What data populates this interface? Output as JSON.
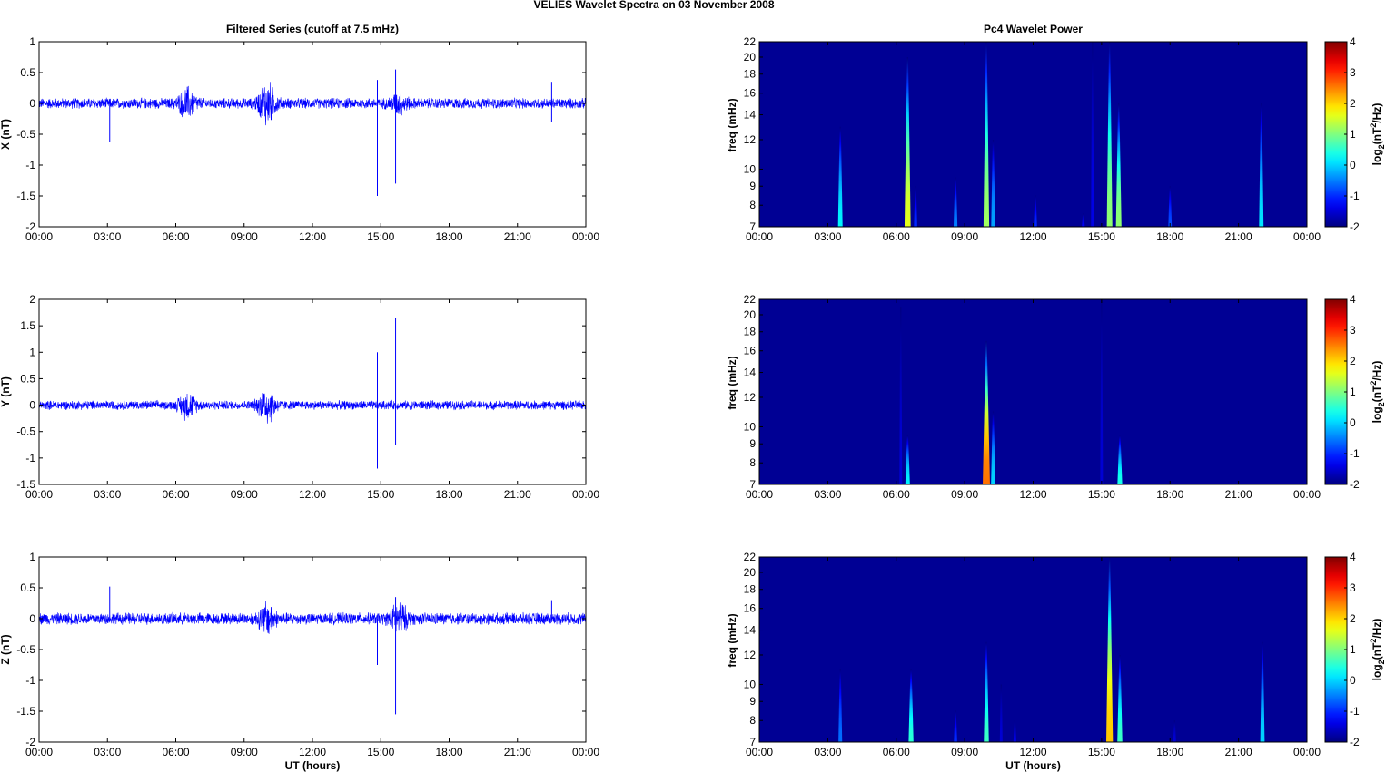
{
  "figure_title": "VELIES Wavelet Spectra on 03 November  2008",
  "chart_data": [
    {
      "type": "line",
      "title": "Filtered Series (cutoff at 7.5 mHz)",
      "component": "X",
      "ylabel": "X (nT)",
      "xlabel": "",
      "xlim": [
        0,
        24
      ],
      "ylim": [
        -2,
        1
      ],
      "yticks": [
        "1",
        "0.5",
        "0",
        "-0.5",
        "-1",
        "-1.5",
        "-2"
      ],
      "yticks_values": [
        1,
        0.5,
        0,
        -0.5,
        -1,
        -1.5,
        -2
      ],
      "noise_amplitude": 0.08,
      "bursts": [
        {
          "t": 6.5,
          "amp": 0.2
        },
        {
          "t": 10.0,
          "amp": 0.3
        },
        {
          "t": 15.8,
          "amp": 0.12
        }
      ],
      "spikes": [
        {
          "t": 3.1,
          "v": -0.62
        },
        {
          "t": 14.85,
          "v": -1.5
        },
        {
          "t": 14.85,
          "v": 0.38
        },
        {
          "t": 15.65,
          "v": 0.55
        },
        {
          "t": 15.65,
          "v": -1.3
        },
        {
          "t": 22.5,
          "v": -0.3
        },
        {
          "t": 22.5,
          "v": 0.35
        }
      ]
    },
    {
      "type": "line",
      "component": "Y",
      "ylabel": "Y (nT)",
      "xlabel": "",
      "xlim": [
        0,
        24
      ],
      "ylim": [
        -1.5,
        2
      ],
      "yticks": [
        "2",
        "1.5",
        "1",
        "0.5",
        "0",
        "-0.5",
        "-1",
        "-1.5"
      ],
      "yticks_values": [
        2,
        1.5,
        1,
        0.5,
        0,
        -0.5,
        -1,
        -1.5
      ],
      "noise_amplitude": 0.08,
      "bursts": [
        {
          "t": 6.5,
          "amp": 0.2
        },
        {
          "t": 10.0,
          "amp": 0.3
        }
      ],
      "spikes": [
        {
          "t": 14.85,
          "v": 1.0
        },
        {
          "t": 14.85,
          "v": -1.2
        },
        {
          "t": 15.65,
          "v": 1.65
        },
        {
          "t": 15.65,
          "v": -0.75
        }
      ]
    },
    {
      "type": "line",
      "component": "Z",
      "ylabel": "Z (nT)",
      "xlabel": "UT (hours)",
      "xlim": [
        0,
        24
      ],
      "ylim": [
        -2,
        1
      ],
      "yticks": [
        "1",
        "0.5",
        "0",
        "-0.5",
        "-1",
        "-1.5",
        "-2"
      ],
      "yticks_values": [
        1,
        0.5,
        0,
        -0.5,
        -1,
        -1.5,
        -2
      ],
      "noise_amplitude": 0.09,
      "bursts": [
        {
          "t": 10.0,
          "amp": 0.2
        },
        {
          "t": 15.8,
          "amp": 0.2
        }
      ],
      "spikes": [
        {
          "t": 3.1,
          "v": 0.52
        },
        {
          "t": 14.85,
          "v": -0.75
        },
        {
          "t": 15.65,
          "v": -1.55
        },
        {
          "t": 15.65,
          "v": 0.35
        },
        {
          "t": 22.5,
          "v": 0.3
        }
      ]
    },
    {
      "type": "heatmap",
      "title": "Pc4 Wavelet Power",
      "component": "X",
      "ylabel": "freq (mHz)",
      "xlabel": "",
      "xlim": [
        0,
        24
      ],
      "ylim": [
        7,
        22
      ],
      "yscale": "log",
      "yticks": [
        "22",
        "20",
        "18",
        "16",
        "14",
        "12",
        "10",
        "9",
        "8",
        "7"
      ],
      "yticks_values": [
        22,
        20,
        18,
        16,
        14,
        12,
        10,
        9,
        8,
        7
      ],
      "colorbar": {
        "label": "log2(nT^2/Hz)",
        "label_base": "log",
        "label_sub": "2",
        "label_mid": "(nT",
        "label_sup": "2",
        "label_end": "/Hz)",
        "range": [
          -2,
          4
        ],
        "ticks": [
          "4",
          "3",
          "2",
          "1",
          "0",
          "-1",
          "-2"
        ],
        "ticks_values": [
          4,
          3,
          2,
          1,
          0,
          -1,
          -2
        ]
      },
      "events": [
        {
          "t": 3.55,
          "fmax": 13,
          "power": 0.2
        },
        {
          "t": 6.5,
          "fmax": 20,
          "power": 1.6
        },
        {
          "t": 6.85,
          "fmax": 9,
          "power": -1
        },
        {
          "t": 8.6,
          "fmax": 9.5,
          "power": -0.5
        },
        {
          "t": 9.95,
          "fmax": 22,
          "power": 1.2
        },
        {
          "t": 10.25,
          "fmax": 12,
          "power": -0.3
        },
        {
          "t": 12.1,
          "fmax": 8.5,
          "power": -1
        },
        {
          "t": 14.2,
          "fmax": 7.6,
          "power": -1.3
        },
        {
          "t": 14.6,
          "fmax": 22,
          "power": -1.4
        },
        {
          "t": 15.35,
          "fmax": 22,
          "power": 1.1
        },
        {
          "t": 15.75,
          "fmax": 15,
          "power": 1.1
        },
        {
          "t": 18.0,
          "fmax": 9,
          "power": -0.8
        },
        {
          "t": 22.0,
          "fmax": 15,
          "power": 0.1
        }
      ]
    },
    {
      "type": "heatmap",
      "component": "Y",
      "ylabel": "freq (mHz)",
      "xlabel": "",
      "xlim": [
        0,
        24
      ],
      "ylim": [
        7,
        22
      ],
      "yscale": "log",
      "yticks": [
        "22",
        "20",
        "18",
        "16",
        "14",
        "12",
        "10",
        "9",
        "8",
        "7"
      ],
      "yticks_values": [
        22,
        20,
        18,
        16,
        14,
        12,
        10,
        9,
        8,
        7
      ],
      "colorbar": {
        "label": "log2(nT^2/Hz)",
        "label_base": "log",
        "label_sub": "2",
        "label_mid": "(nT",
        "label_sup": "2",
        "label_end": "/Hz)",
        "range": [
          -2,
          4
        ],
        "ticks": [
          "4",
          "3",
          "2",
          "1",
          "0",
          "-1",
          "-2"
        ],
        "ticks_values": [
          4,
          3,
          2,
          1,
          0,
          -1,
          -2
        ]
      },
      "events": [
        {
          "t": 6.2,
          "fmax": 21,
          "power": -1.5
        },
        {
          "t": 6.5,
          "fmax": 9.5,
          "power": 0.2
        },
        {
          "t": 9.95,
          "fmax": 17,
          "power": 2.6
        },
        {
          "t": 10.25,
          "fmax": 11,
          "power": 0
        },
        {
          "t": 15.0,
          "fmax": 22,
          "power": -1.5
        },
        {
          "t": 15.8,
          "fmax": 9.5,
          "power": 0.4
        }
      ]
    },
    {
      "type": "heatmap",
      "component": "Z",
      "ylabel": "freq (mHz)",
      "xlabel": "UT (hours)",
      "xlim": [
        0,
        24
      ],
      "ylim": [
        7,
        22
      ],
      "yscale": "log",
      "yticks": [
        "22",
        "20",
        "18",
        "16",
        "14",
        "12",
        "10",
        "9",
        "8",
        "7"
      ],
      "yticks_values": [
        22,
        20,
        18,
        16,
        14,
        12,
        10,
        9,
        8,
        7
      ],
      "colorbar": {
        "label": "log2(nT^2/Hz)",
        "label_base": "log",
        "label_sub": "2",
        "label_mid": "(nT",
        "label_sup": "2",
        "label_end": "/Hz)",
        "range": [
          -2,
          4
        ],
        "ticks": [
          "4",
          "3",
          "2",
          "1",
          "0",
          "-1",
          "-2"
        ],
        "ticks_values": [
          4,
          3,
          2,
          1,
          0,
          -1,
          -2
        ]
      },
      "events": [
        {
          "t": 3.55,
          "fmax": 11,
          "power": -0.6
        },
        {
          "t": 6.65,
          "fmax": 11,
          "power": 0.5
        },
        {
          "t": 8.6,
          "fmax": 8.5,
          "power": -1
        },
        {
          "t": 9.95,
          "fmax": 13,
          "power": 0.6
        },
        {
          "t": 10.6,
          "fmax": 10,
          "power": -1.5
        },
        {
          "t": 11.2,
          "fmax": 8,
          "power": -1.4
        },
        {
          "t": 15.35,
          "fmax": 22,
          "power": 2.1
        },
        {
          "t": 15.8,
          "fmax": 12,
          "power": 0.6
        },
        {
          "t": 18.2,
          "fmax": 8,
          "power": -1.5
        },
        {
          "t": 22.05,
          "fmax": 13,
          "power": 0
        }
      ]
    }
  ],
  "xticks": [
    "00:00",
    "03:00",
    "06:00",
    "09:00",
    "12:00",
    "15:00",
    "18:00",
    "21:00",
    "00:00"
  ],
  "xticks_values": [
    0,
    3,
    6,
    9,
    12,
    15,
    18,
    21,
    24
  ]
}
